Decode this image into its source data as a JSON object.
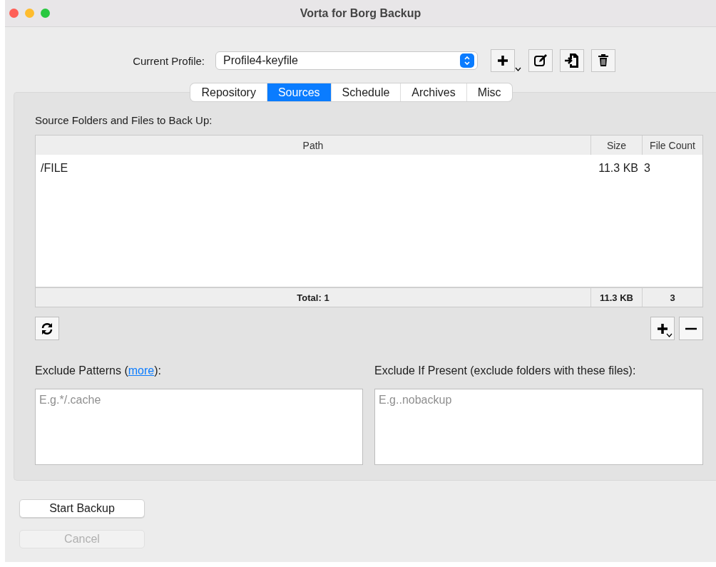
{
  "window": {
    "title": "Vorta for Borg Backup"
  },
  "profile": {
    "label": "Current Profile:",
    "value": "Profile4-keyfile"
  },
  "tabs": [
    {
      "label": "Repository",
      "selected": false
    },
    {
      "label": "Sources",
      "selected": true
    },
    {
      "label": "Schedule",
      "selected": false
    },
    {
      "label": "Archives",
      "selected": false
    },
    {
      "label": "Misc",
      "selected": false
    }
  ],
  "sources": {
    "label": "Source Folders and Files to Back Up:",
    "columns": [
      "Path",
      "Size",
      "File Count"
    ],
    "rows": [
      {
        "path": "/FILE",
        "size": "11.3 KB",
        "count": "3"
      }
    ],
    "totals": {
      "path": "Total: 1",
      "size": "11.3 KB",
      "count": "3"
    }
  },
  "exclude_patterns": {
    "label_before": "Exclude Patterns (",
    "link": "more",
    "label_after": "):",
    "placeholder": "E.g.*/.cache"
  },
  "exclude_if_present": {
    "label": "Exclude If Present (exclude folders with these files):",
    "placeholder": "E.g..nobackup"
  },
  "buttons": [
    {
      "label": "Start Backup",
      "disabled": false
    },
    {
      "label": "Cancel",
      "disabled": true
    }
  ]
}
